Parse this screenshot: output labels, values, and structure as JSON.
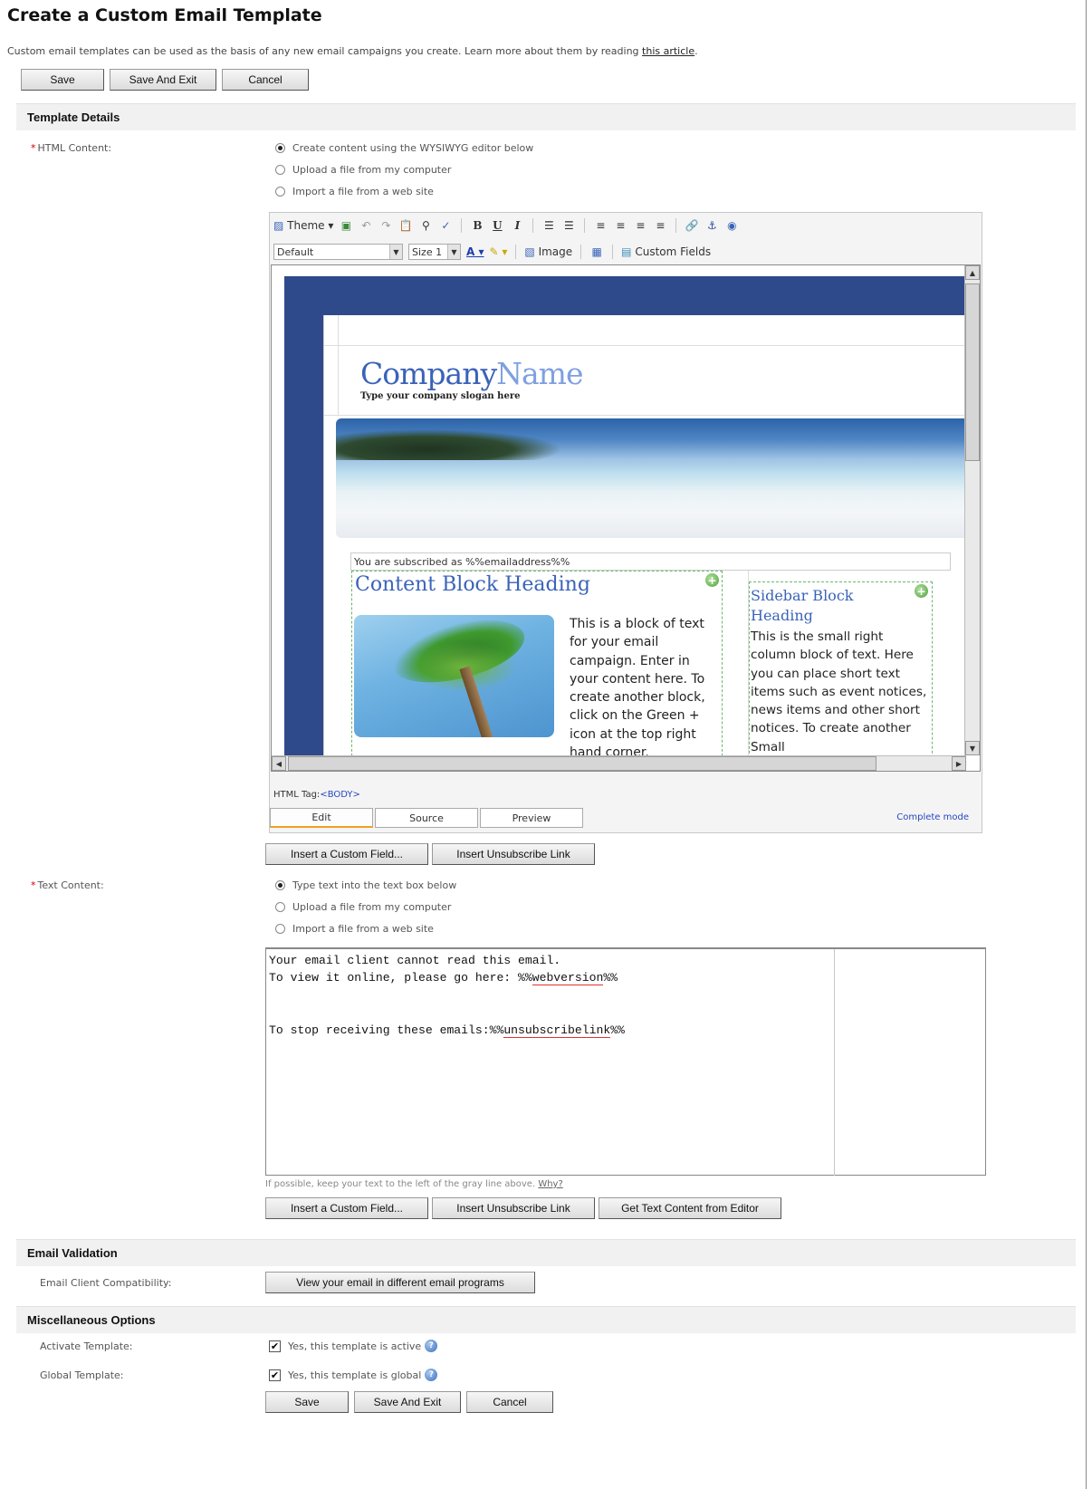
{
  "page": {
    "title": "Create a Custom Email Template",
    "intro": "Custom email templates can be used as the basis of any new email campaigns you create. Learn more about them by reading ",
    "intro_link": "this article",
    "intro_end": "."
  },
  "top_buttons": {
    "save": "Save",
    "save_exit": "Save And Exit",
    "cancel": "Cancel"
  },
  "template_details": {
    "heading": "Template Details",
    "html_label": "HTML Content:",
    "html_options": [
      "Create content using the WYSIWYG editor below",
      "Upload a file from my computer",
      "Import a file from a web site"
    ],
    "html_selected": 0,
    "toolbar": {
      "theme": "Theme",
      "font": "Default",
      "size": "Size 1",
      "image": "Image",
      "custom_fields": "Custom Fields",
      "bold": "B",
      "underline": "U",
      "italic": "I"
    },
    "preview": {
      "company_a": "Company",
      "company_b": "Name",
      "slogan": "Type your company slogan here",
      "subscribed": "You are subscribed as %%emailaddress%%",
      "block_heading": "Content Block Heading",
      "block_text": "This is a block of text for your email campaign. Enter in your content here. To create another block, click on the Green + icon at the top right hand corner.",
      "sidebar_heading": "Sidebar Block Heading",
      "sidebar_text": "This is the small right column block of text. Here you can place short text items such as event notices, news items and other short notices. To create another Small"
    },
    "html_tag_label": "HTML Tag:",
    "html_tag_value": "<BODY>",
    "editor_tabs": [
      "Edit",
      "Source",
      "Preview"
    ],
    "complete_mode": "Complete mode",
    "insert_custom_field": "Insert a Custom Field...",
    "insert_unsubscribe": "Insert Unsubscribe Link",
    "text_label": "Text Content:",
    "text_options": [
      "Type text into the text box below",
      "Upload a file from my computer",
      "Import a file from a web site"
    ],
    "text_selected": 0,
    "text_line1": "Your email client cannot read this email.",
    "text_line2a": "To view it online, please go here: %%",
    "text_line2b": "webversion",
    "text_line2c": "%%",
    "text_line3a": "To stop receiving these emails:%%",
    "text_line3b": "unsubscribelink",
    "text_line3c": "%%",
    "hint": "If possible, keep your text to the left of the gray line above. ",
    "hint_link": "Why?",
    "get_text": "Get Text Content from Editor"
  },
  "email_validation": {
    "heading": "Email Validation",
    "label": "Email Client Compatibility:",
    "button": "View your email in different email programs"
  },
  "misc": {
    "heading": "Miscellaneous Options",
    "activate_label": "Activate Template:",
    "activate_text": "Yes, this template is active",
    "activate_checked": true,
    "global_label": "Global Template:",
    "global_text": "Yes, this template is global",
    "global_checked": true
  },
  "bottom_buttons": {
    "save": "Save",
    "save_exit": "Save And Exit",
    "cancel": "Cancel"
  },
  "colors": {
    "heading_blue": "#3a63b8",
    "frame_blue": "#2e4a8a",
    "required": "#cc0000",
    "section_bg": "#f1f1f1"
  }
}
